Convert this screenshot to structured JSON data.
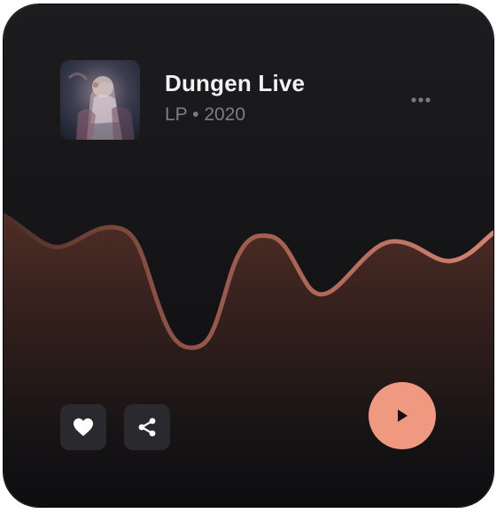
{
  "album": {
    "title": "Dungen Live",
    "subtitle": "LP • 2020",
    "cover_icon": "album-cover-art"
  },
  "menu": {
    "icon": "more-horizontal-icon"
  },
  "waveform": {
    "stroke_color": "#c57262",
    "fill_color": "#5a3128"
  },
  "actions": {
    "like_icon": "heart-icon",
    "share_icon": "share-icon",
    "play_icon": "play-icon",
    "play_color": "#ef9a80"
  }
}
